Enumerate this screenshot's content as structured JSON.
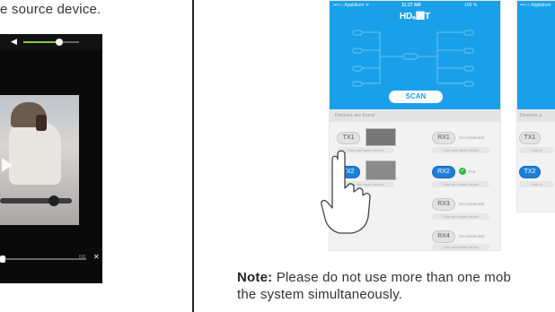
{
  "intro_fragment": "e source device.",
  "left_phone": {
    "time": "0:0"
  },
  "center_phone": {
    "status_left": "•••○○ Applidium ᯤ",
    "status_time": "11:27 AM",
    "status_batt": "100 %",
    "logo": "HDₐ₞T",
    "scan_label": "SCAN",
    "found_label": "Devices are found",
    "tx": [
      {
        "label": "TX1",
        "hint": "Click and name device",
        "selected": false
      },
      {
        "label": "TX2",
        "hint": "Click and name device",
        "selected": true
      }
    ],
    "rx": [
      {
        "label": "RX1",
        "status": "Un-connected",
        "hint": "Click and name device",
        "selected": false
      },
      {
        "label": "RX2",
        "status": "TX2",
        "hint": "Click and name device",
        "selected": true,
        "connected": true
      },
      {
        "label": "RX3",
        "status": "Un-connected",
        "hint": "Click and name device",
        "selected": false
      },
      {
        "label": "RX4",
        "status": "Un-connected",
        "hint": "Click and name device",
        "selected": false
      }
    ]
  },
  "right_phone": {
    "status_left": "•••○○ Applidium",
    "found_label": "Devices a",
    "tx1": "TX1",
    "tx2": "TX2",
    "hint_frag": "Click a"
  },
  "note": {
    "label": "Note:",
    "line1": " Please do not use more than one mob",
    "line2": "the system simultaneously."
  },
  "colors": {
    "accent_blue": "#1aa0e8",
    "selected_blue": "#1e7fd8",
    "connected_green": "#38b84a",
    "volume_green": "#8ec63f"
  }
}
